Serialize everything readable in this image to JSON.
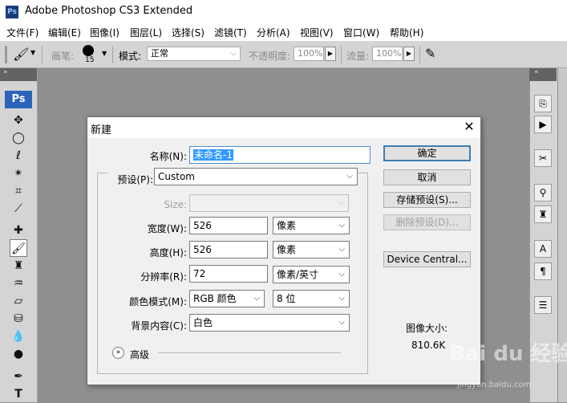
{
  "app": {
    "icon": "Ps",
    "title": "Adobe Photoshop CS3 Extended"
  },
  "menu": [
    {
      "label": "文件(F)"
    },
    {
      "label": "编辑(E)"
    },
    {
      "label": "图像(I)"
    },
    {
      "label": "图层(L)"
    },
    {
      "label": "选择(S)"
    },
    {
      "label": "滤镜(T)"
    },
    {
      "label": "分析(A)"
    },
    {
      "label": "视图(V)"
    },
    {
      "label": "窗口(W)"
    },
    {
      "label": "帮助(H)"
    }
  ],
  "options": {
    "brush_label": "画笔:",
    "brush_size": "15",
    "mode_label": "模式:",
    "mode_value": "正常",
    "opacity_label": "不透明度:",
    "opacity_value": "100%",
    "flow_label": "流量:",
    "flow_value": "100%"
  },
  "toolbox": {
    "badge": "Ps"
  },
  "dialog": {
    "title": "新建",
    "name_label": "名称(N):",
    "name_value": "未命名-1",
    "preset_label": "预设(P):",
    "preset_value": "Custom",
    "size_label": "Size:",
    "size_value": "",
    "width_label": "宽度(W):",
    "width_value": "526",
    "width_unit": "像素",
    "height_label": "高度(H):",
    "height_value": "526",
    "height_unit": "像素",
    "resolution_label": "分辨率(R):",
    "resolution_value": "72",
    "resolution_unit": "像素/英寸",
    "color_mode_label": "颜色模式(M):",
    "color_mode_value": "RGB 颜色",
    "bit_depth_value": "8 位",
    "background_label": "背景内容(C):",
    "background_value": "白色",
    "advanced_label": "高级",
    "ok_label": "确定",
    "cancel_label": "取消",
    "save_preset_label": "存储预设(S)...",
    "delete_preset_label": "删除预设(D)...",
    "device_central_label": "Device Central...",
    "image_size_label": "图像大小:",
    "image_size_value": "810.6K"
  },
  "watermark": {
    "brand": "Bai du 经验",
    "url": "jingyan.baidu.com"
  },
  "colors": {
    "canvas_bg": "#8f8f8f",
    "panel_bg": "#d4d4d4",
    "ps_blue": "#2a63b8",
    "selection": "#3399ff",
    "default_btn_border": "#3c7fb1"
  }
}
